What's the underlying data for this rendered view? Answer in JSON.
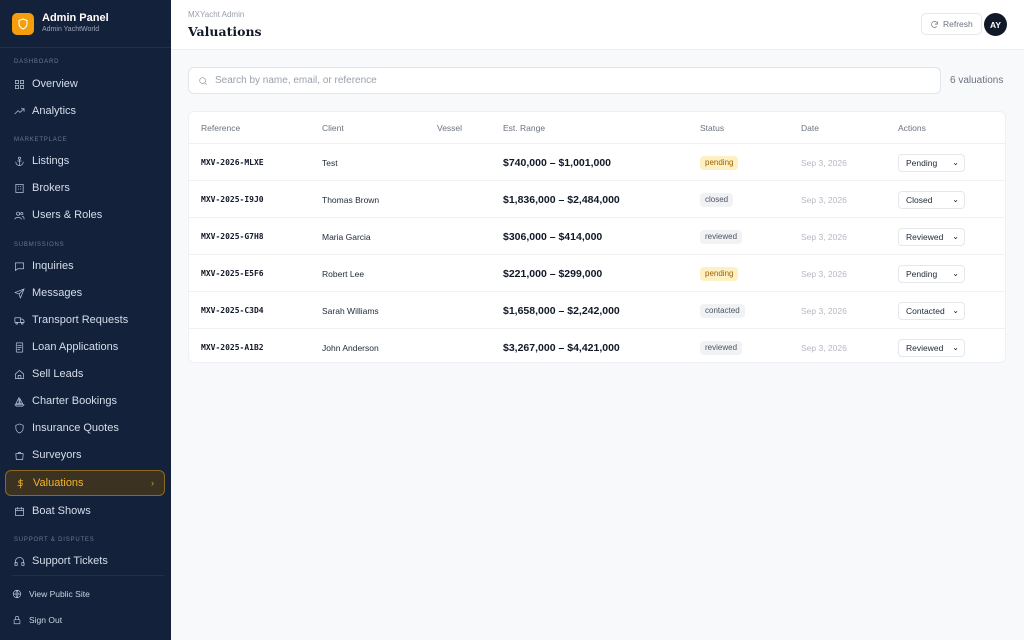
{
  "sidebar": {
    "brand_title": "Admin Panel",
    "brand_subtitle": "Admin YachtWorld",
    "sections": {
      "dashboard": "DASHBOARD",
      "marketplace": "MARKETPLACE",
      "submissions": "SUBMISSIONS",
      "support": "SUPPORT & DISPUTES"
    },
    "items": {
      "overview": "Overview",
      "analytics": "Analytics",
      "listings": "Listings",
      "brokers": "Brokers",
      "users_roles": "Users & Roles",
      "inquiries": "Inquiries",
      "messages": "Messages",
      "transport": "Transport Requests",
      "loans": "Loan Applications",
      "sell_leads": "Sell Leads",
      "charter": "Charter Bookings",
      "insurance": "Insurance Quotes",
      "surveyors": "Surveyors",
      "valuations": "Valuations",
      "boat_shows": "Boat Shows",
      "support_tickets": "Support Tickets"
    },
    "active_item": "valuations",
    "footer": {
      "view_site": "View Public Site",
      "sign_out": "Sign Out"
    }
  },
  "header": {
    "breadcrumb": "MXYacht Admin",
    "title": "Valuations",
    "refresh_label": "Refresh",
    "avatar_initials": "AY"
  },
  "search": {
    "placeholder": "Search by name, email, or reference",
    "value": "",
    "count_label": "6 valuations"
  },
  "table": {
    "columns": [
      "Reference",
      "Client",
      "Vessel",
      "Est. Range",
      "Status",
      "Date",
      "Actions"
    ],
    "rows": [
      {
        "reference": "MXV-2026-MLXE",
        "client": "Test",
        "vessel": "",
        "range": "$740,000 – $1,001,000",
        "status": "pending",
        "date": "Sep 3, 2026",
        "action": "Pending"
      },
      {
        "reference": "MXV-2025-I9J0",
        "client": "Thomas Brown",
        "vessel": "",
        "range": "$1,836,000 – $2,484,000",
        "status": "closed",
        "date": "Sep 3, 2026",
        "action": "Closed"
      },
      {
        "reference": "MXV-2025-G7H8",
        "client": "Maria Garcia",
        "vessel": "",
        "range": "$306,000 – $414,000",
        "status": "reviewed",
        "date": "Sep 3, 2026",
        "action": "Reviewed"
      },
      {
        "reference": "MXV-2025-E5F6",
        "client": "Robert Lee",
        "vessel": "",
        "range": "$221,000 – $299,000",
        "status": "pending",
        "date": "Sep 3, 2026",
        "action": "Pending"
      },
      {
        "reference": "MXV-2025-C3D4",
        "client": "Sarah Williams",
        "vessel": "",
        "range": "$1,658,000 – $2,242,000",
        "status": "contacted",
        "date": "Sep 3, 2026",
        "action": "Contacted"
      },
      {
        "reference": "MXV-2025-A1B2",
        "client": "John Anderson",
        "vessel": "",
        "range": "$3,267,000 – $4,421,000",
        "status": "reviewed",
        "date": "Sep 3, 2026",
        "action": "Reviewed"
      }
    ]
  },
  "colors": {
    "sidebar_bg": "#14213a",
    "accent": "#f59e0b",
    "pending_bg": "#fdf0c2",
    "pending_text": "#a16207",
    "neutral_badge_bg": "#f1f2f4",
    "neutral_badge_text": "#4b5563"
  }
}
